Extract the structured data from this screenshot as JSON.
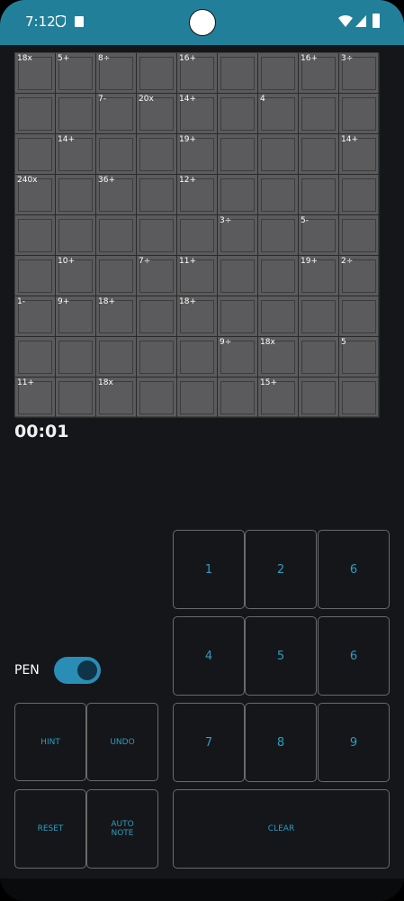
{
  "status": {
    "time": "7:12"
  },
  "grid": {
    "size": 9,
    "cells": [
      [
        "18x",
        "5+",
        "8÷",
        "",
        "16+",
        "",
        "",
        "16+",
        "3÷"
      ],
      [
        "",
        "",
        "7-",
        "20x",
        "14+",
        "",
        "4",
        "",
        ""
      ],
      [
        "",
        "14+",
        "",
        "",
        "19+",
        "",
        "",
        "",
        "14+"
      ],
      [
        "240x",
        "",
        "36+",
        "",
        "12+",
        "",
        "",
        "",
        ""
      ],
      [
        "",
        "",
        "",
        "",
        "",
        "3÷",
        "",
        "5-",
        ""
      ],
      [
        "",
        "10+",
        "",
        "7÷",
        "11+",
        "",
        "",
        "19+",
        "2÷"
      ],
      [
        "1-",
        "9+",
        "18+",
        "",
        "18+",
        "",
        "",
        "",
        ""
      ],
      [
        "",
        "",
        "",
        "",
        "",
        "9÷",
        "18x",
        "",
        "5"
      ],
      [
        "11+",
        "",
        "18x",
        "",
        "",
        "",
        "15+",
        "",
        ""
      ]
    ]
  },
  "timer": "00:01",
  "pen": {
    "label": "PEN",
    "on": true
  },
  "buttons": {
    "hint": "HINT",
    "undo": "UNDO",
    "reset": "RESET",
    "auto_note": "AUTO\nNOTE",
    "clear": "CLEAR"
  },
  "keypad": [
    "1",
    "2",
    "6",
    "4",
    "5",
    "6",
    "7",
    "8",
    "9"
  ],
  "colors": {
    "accent": "#2f9dbd",
    "status_bar": "#227f99",
    "background": "#14161a",
    "grid": "#5b5a5c"
  }
}
